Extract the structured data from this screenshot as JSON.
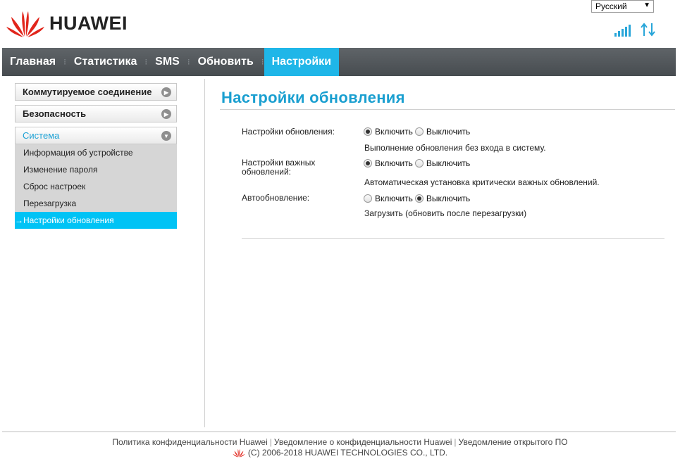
{
  "header": {
    "brand": "HUAWEI",
    "language": "Русский"
  },
  "nav": {
    "items": [
      {
        "label": "Главная"
      },
      {
        "label": "Статистика"
      },
      {
        "label": "SMS"
      },
      {
        "label": "Обновить"
      },
      {
        "label": "Настройки"
      }
    ],
    "active": "Настройки"
  },
  "sidebar": {
    "sections": [
      {
        "label": "Коммутируемое соединение"
      },
      {
        "label": "Безопасность"
      },
      {
        "label": "Система"
      }
    ],
    "system_items": [
      {
        "label": "Информация об устройстве"
      },
      {
        "label": "Изменение пароля"
      },
      {
        "label": "Сброс настроек"
      },
      {
        "label": "Перезагрузка"
      },
      {
        "label": "Настройки обновления",
        "active_prefix": "→"
      }
    ]
  },
  "main": {
    "title": "Настройки обновления",
    "rows": [
      {
        "label": "Настройки обновления:",
        "option_on": "Включить",
        "option_off": "Выключить",
        "selected": "on",
        "description": "Выполнение обновления без входа в систему."
      },
      {
        "label_line1": "Настройки важных",
        "label_line2": "обновлений:",
        "option_on": "Включить",
        "option_off": "Выключить",
        "selected": "on",
        "description": "Автоматическая установка критически важных обновлений."
      },
      {
        "label": "Автообновление:",
        "option_on": "Включить",
        "option_off": "Выключить",
        "selected": "off",
        "description": "Загрузить (обновить после перезагрузки)"
      }
    ]
  },
  "footer": {
    "links": [
      "Политика конфиденциальности Huawei",
      "Уведомление о конфиденциальности Huawei",
      "Уведомление открытого ПО"
    ],
    "copyright": "(C) 2006-2018 HUAWEI TECHNOLOGIES CO., LTD."
  },
  "colors": {
    "accent": "#1fb6e8",
    "title": "#1a9fd0",
    "brand_red": "#e1251b",
    "navbar": "#505559"
  },
  "status": {
    "signal_icon": "signal-bars-icon",
    "data_icon": "up-down-arrows-icon"
  }
}
